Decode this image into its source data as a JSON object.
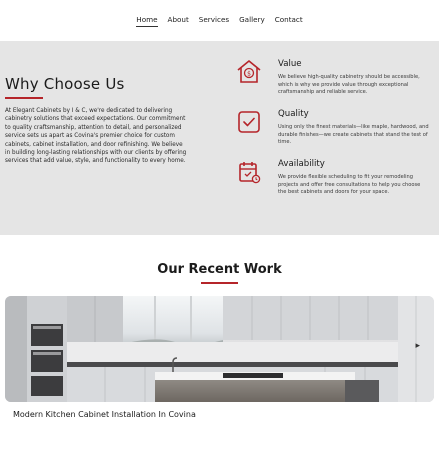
{
  "nav": {
    "items": [
      "Home",
      "About",
      "Services",
      "Gallery",
      "Contact"
    ],
    "active": "Home"
  },
  "why": {
    "title": "Why Choose Us",
    "body": "At Elegant Cabinets by I & C, we're dedicated to delivering cabinetry solutions that exceed expectations. Our commitment to quality craftsmanship, attention to detail, and personalized service sets us apart as Covina's premier choice for custom cabinets, cabinet installation, and door refinishing. We believe in building long-lasting relationships with our clients by offering services that add value, style, and functionality to every home.",
    "features": [
      {
        "icon": "house-dollar-icon",
        "title": "Value",
        "text": "We believe high-quality cabinetry should be accessible, which is why we provide value through exceptional craftsmanship and reliable service."
      },
      {
        "icon": "checkbox-icon",
        "title": "Quality",
        "text": "Using only the finest materials—like maple, hardwood, and durable finishes—we create cabinets that stand the test of time."
      },
      {
        "icon": "calendar-icon",
        "title": "Availability",
        "text": "We provide flexible scheduling to fit your remodeling projects and offer free consultations to help you choose the best cabinets and doors for your space."
      }
    ]
  },
  "recent": {
    "title": "Our Recent Work",
    "caption": "Modern Kitchen Cabinet Installation In Covina",
    "next_icon": "chevron-right-icon"
  },
  "colors": {
    "accent": "#b5252a",
    "section_bg": "#e5e5e5"
  }
}
